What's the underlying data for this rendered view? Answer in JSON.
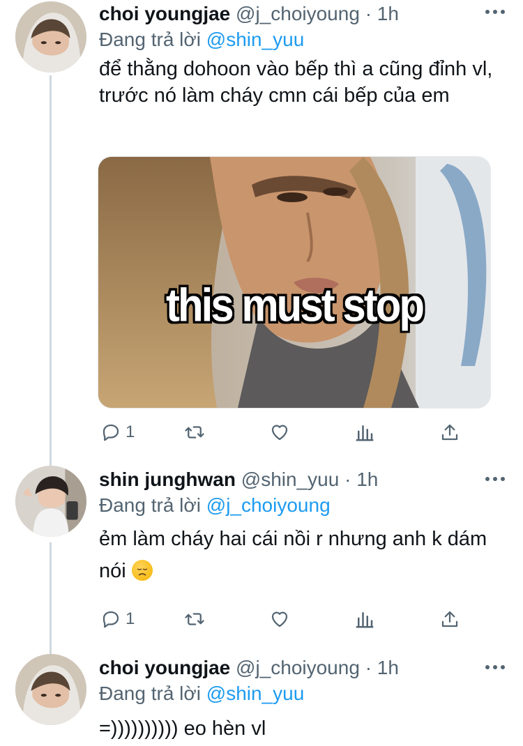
{
  "tweets": [
    {
      "name": "choi youngjae",
      "handle": "@j_choiyoung",
      "separator": "·",
      "time": "1h",
      "reply_prefix": "Đang trả lời",
      "reply_mention": "@shin_yuu",
      "text": "để thằng dohoon vào bếp thì a cũng đỉnh vl, trước nó làm cháy cmn cái bếp của em",
      "media_caption": "this must stop",
      "reply_count": "1"
    },
    {
      "name": "shin junghwan",
      "handle": "@shin_yuu",
      "separator": "·",
      "time": "1h",
      "reply_prefix": "Đang trả lời",
      "reply_mention": "@j_choiyoung",
      "text": "ẻm làm cháy hai cái nồi r nhưng anh k dám nói",
      "emoji": "disappointed-face",
      "reply_count": "1"
    },
    {
      "name": "choi youngjae",
      "handle": "@j_choiyoung",
      "separator": "·",
      "time": "1h",
      "reply_prefix": "Đang trả lời",
      "reply_mention": "@shin_yuu",
      "text": "=)))))))))) eo hèn vl"
    }
  ],
  "icons": {
    "reply": "reply-icon",
    "retweet": "retweet-icon",
    "like": "like-icon",
    "analytics": "analytics-icon",
    "share": "share-icon",
    "more": "more-icon"
  },
  "colors": {
    "link": "#1d9bf0",
    "secondary_text": "#536471",
    "primary_text": "#0f1419",
    "thread_line": "#cfd9de"
  }
}
